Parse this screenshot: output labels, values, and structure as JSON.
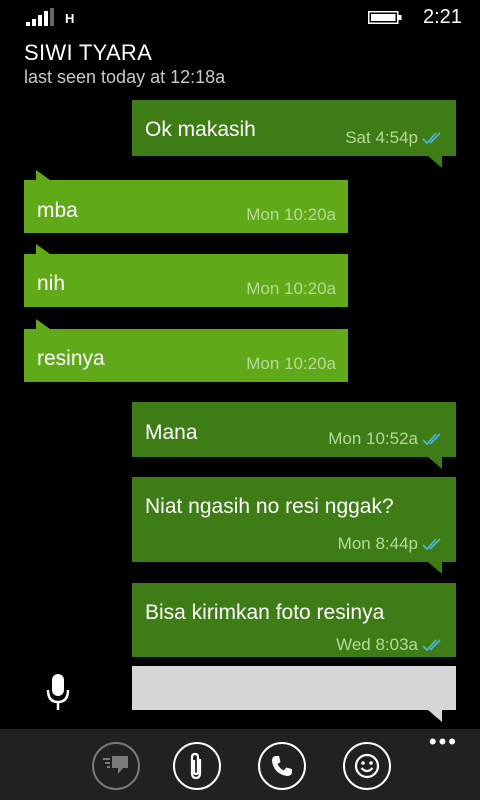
{
  "status": {
    "network_type": "H",
    "time": "2:21"
  },
  "header": {
    "contact_name": "SIWI TYARA",
    "last_seen": "last seen today at 12:18a"
  },
  "messages": [
    {
      "direction": "out",
      "text": "Ok makasih",
      "time": "Sat 4:54p",
      "read": true
    },
    {
      "direction": "in",
      "text": "mba",
      "time": "Mon 10:20a"
    },
    {
      "direction": "in",
      "text": "nih",
      "time": "Mon 10:20a"
    },
    {
      "direction": "in",
      "text": "resinya",
      "time": "Mon 10:20a"
    },
    {
      "direction": "out",
      "text": "Mana",
      "time": "Mon 10:52a",
      "read": true
    },
    {
      "direction": "out",
      "text": "Niat ngasih no resi nggak?",
      "time": "Mon 8:44p",
      "read": true
    },
    {
      "direction": "out",
      "text": "Bisa kirimkan foto resinya",
      "time": "Wed 8:03a",
      "read": true
    }
  ],
  "composer": {
    "value": ""
  },
  "app_bar": {
    "buttons": [
      {
        "icon": "quick-reply-icon",
        "enabled": false
      },
      {
        "icon": "paperclip-icon",
        "enabled": true
      },
      {
        "icon": "phone-icon",
        "enabled": true
      },
      {
        "icon": "smiley-icon",
        "enabled": true
      }
    ],
    "more": "•••"
  },
  "colors": {
    "incoming_bubble": "#60a918",
    "outgoing_bubble": "#3e7c15",
    "read_tick": "#4ab8e8",
    "app_bar": "#212121"
  }
}
